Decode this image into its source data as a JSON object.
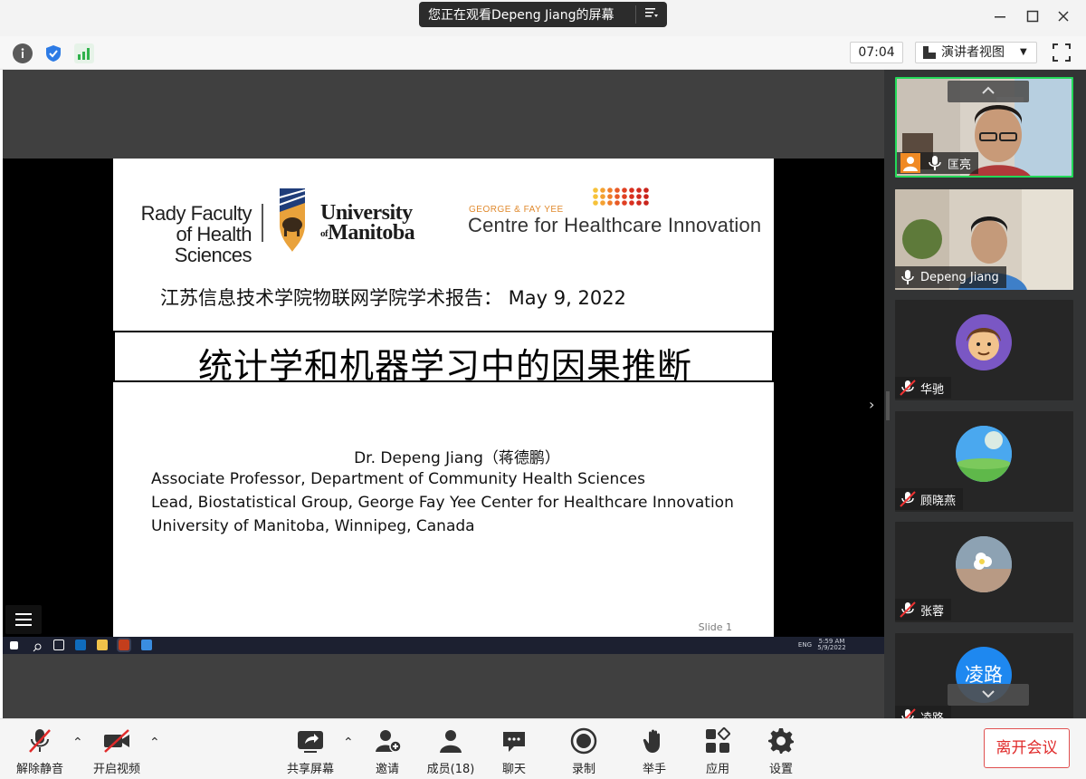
{
  "window": {
    "viewing_banner": "您正在观看Depeng Jiang的屏幕",
    "minimize": "—",
    "maximize": "☐",
    "close": "✕"
  },
  "toolbar": {
    "timer": "07:04",
    "view_mode": "演讲者视图"
  },
  "slide": {
    "logo_rady": "Rady Faculty of Health Sciences",
    "logo_university": "University",
    "logo_of": "of",
    "logo_manitoba": "Manitoba",
    "logo_cgfy_small": "GEORGE & FAY YEE",
    "logo_cgfy_big": "Centre for Healthcare Innovation",
    "report_line": "江苏信息技术学院物联网学院学术报告：  May 9, 2022",
    "title": "统计学和机器学习中的因果推断",
    "author": "Dr. Depeng Jiang（蒋德鹏）",
    "affiliations": [
      "Associate Professor, Department of Community Health Sciences",
      "Lead, Biostatistical Group, George Fay Yee Center for Healthcare Innovation",
      "University of Manitoba, Winnipeg, Canada"
    ],
    "slide_number": "Slide 1"
  },
  "taskbar": {
    "time": "5:59 AM",
    "date": "5/9/2022",
    "lang": "ENG"
  },
  "participants": [
    {
      "name": "匡亮",
      "muted": false,
      "type": "video"
    },
    {
      "name": "Depeng Jiang",
      "muted": false,
      "type": "video"
    },
    {
      "name": "华驰",
      "muted": true,
      "type": "avatar"
    },
    {
      "name": "顾晓燕",
      "muted": true,
      "type": "avatar"
    },
    {
      "name": "张蓉",
      "muted": true,
      "type": "avatar"
    },
    {
      "name": "凌路",
      "muted": true,
      "type": "initials",
      "initials": "凌路"
    }
  ],
  "bottombar": {
    "unmute": "解除静音",
    "start_video": "开启视频",
    "share_screen": "共享屏幕",
    "invite": "邀请",
    "participants": "成员(18)",
    "chat": "聊天",
    "record": "录制",
    "raise_hand": "举手",
    "apps": "应用",
    "settings": "设置",
    "leave": "离开会议"
  },
  "colors": {
    "accent_green": "#23d959",
    "leave_red": "#e02a2a",
    "initials_blue": "#1e88f0"
  }
}
